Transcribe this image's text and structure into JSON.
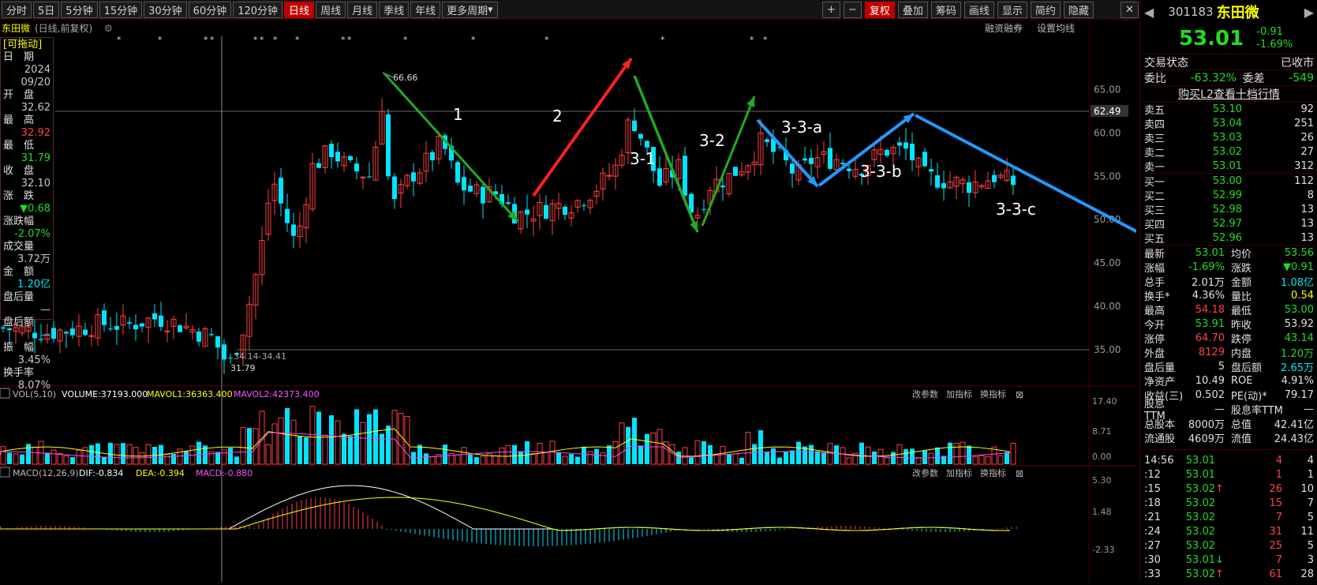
{
  "toolbar": {
    "periods": [
      "分时",
      "5日",
      "5分钟",
      "15分钟",
      "30分钟",
      "60分钟",
      "120分钟",
      "日线",
      "周线",
      "月线",
      "季线",
      "年线",
      "更多周期"
    ],
    "active": "日线",
    "right_buttons": [
      "+",
      "−",
      "复权",
      "叠加",
      "筹码",
      "画线",
      "显示",
      "简约",
      "隐藏"
    ]
  },
  "chart_header": {
    "name": "东田微",
    "mode": "(日线,前复权)",
    "links": [
      "融资融券",
      "设置均线"
    ]
  },
  "infopanel": {
    "drag": "[可拖动]",
    "rows": [
      {
        "label": "日　期",
        "value": "2024"
      },
      {
        "label": "",
        "value": "09/20"
      },
      {
        "label": "开　盘",
        "value": "32.62"
      },
      {
        "label": "最　高",
        "value": "32.92"
      },
      {
        "label": "最　低",
        "value": "31.79"
      },
      {
        "label": "收　盘",
        "value": "32.10"
      },
      {
        "label": "涨　跌",
        "value": "▼0.68"
      },
      {
        "label": "涨跌幅",
        "value": "-2.07%"
      },
      {
        "label": "成交量",
        "value": ""
      },
      {
        "label": "",
        "value": "3.72万"
      },
      {
        "label": "金　额",
        "value": ""
      },
      {
        "label": "",
        "value": "1.20亿"
      },
      {
        "label": "盘后量",
        "value": "—"
      },
      {
        "label": "盘后额",
        "value": "—"
      },
      {
        "label": "振　幅",
        "value": ""
      },
      {
        "label": "",
        "value": "3.45%"
      },
      {
        "label": "换手率",
        "value": ""
      },
      {
        "label": "",
        "value": "8.07%"
      }
    ]
  },
  "price_axis": [
    "65.00",
    "62.49",
    "60.00",
    "55.00",
    "50.00",
    "45.00",
    "40.00",
    "35.00"
  ],
  "annotations": {
    "high_label": "66.66",
    "low_label": "31.79",
    "range_label": "34.14-34.41",
    "waves": [
      "1",
      "2",
      "3-1",
      "3-2",
      "3-3-a",
      "3-3-b",
      "3-3-c"
    ]
  },
  "vol_panel": {
    "title": "VOL(5,10)",
    "volume": "VOLUME:37193.000",
    "mavol1": "MAVOL1:36363.400",
    "mavol2": "MAVOL2:42373.400",
    "links": [
      "改参数",
      "加指标",
      "换指标"
    ],
    "axis": [
      "17.40",
      "8.71",
      "0.00"
    ]
  },
  "macd_panel": {
    "title": "MACD(12,26,9)",
    "dif": "DIF:-0.834",
    "dea": "DEA:-0.394",
    "macd": "MACD:-0.880",
    "links": [
      "改参数",
      "加指标",
      "换指标"
    ],
    "axis": [
      "5.30",
      "1.48",
      "-2.33"
    ]
  },
  "quote": {
    "code": "301183",
    "name": "东田微",
    "price": "53.01",
    "change": "-0.91",
    "pct": "-1.69%",
    "status_label": "交易状态",
    "status": "已收市",
    "weibi_label": "委比",
    "weibi": "-63.32%",
    "weicha_label": "委差",
    "weicha": "-549",
    "l2": "购买L2查看十档行情",
    "asks": [
      {
        "label": "卖五",
        "price": "53.10",
        "vol": "92"
      },
      {
        "label": "卖四",
        "price": "53.04",
        "vol": "251"
      },
      {
        "label": "卖三",
        "price": "53.03",
        "vol": "26"
      },
      {
        "label": "卖二",
        "price": "53.02",
        "vol": "27"
      },
      {
        "label": "卖一",
        "price": "53.01",
        "vol": "312"
      }
    ],
    "bids": [
      {
        "label": "买一",
        "price": "53.00",
        "vol": "112"
      },
      {
        "label": "买二",
        "price": "52.99",
        "vol": "8"
      },
      {
        "label": "买三",
        "price": "52.98",
        "vol": "13"
      },
      {
        "label": "买四",
        "price": "52.97",
        "vol": "13"
      },
      {
        "label": "买五",
        "price": "52.96",
        "vol": "13"
      }
    ],
    "stats": [
      {
        "l1": "最新",
        "v1": "53.01",
        "c1": "g",
        "l2": "均价",
        "v2": "53.56",
        "c2": "g"
      },
      {
        "l1": "涨幅",
        "v1": "-1.69%",
        "c1": "g",
        "l2": "涨跌",
        "v2": "▼0.91",
        "c2": "g"
      },
      {
        "l1": "总手",
        "v1": "2.01万",
        "c1": "w",
        "l2": "金额",
        "v2": "1.08亿",
        "c2": "c"
      },
      {
        "l1": "换手*",
        "v1": "4.36%",
        "c1": "w",
        "l2": "量比",
        "v2": "0.54",
        "c2": "y"
      },
      {
        "l1": "最高",
        "v1": "54.18",
        "c1": "r",
        "l2": "最低",
        "v2": "53.00",
        "c2": "g"
      },
      {
        "l1": "今开",
        "v1": "53.91",
        "c1": "g",
        "l2": "昨收",
        "v2": "53.92",
        "c2": "w"
      },
      {
        "l1": "涨停",
        "v1": "64.70",
        "c1": "r",
        "l2": "跌停",
        "v2": "43.14",
        "c2": "g"
      },
      {
        "l1": "外盘",
        "v1": "8129",
        "c1": "r",
        "l2": "内盘",
        "v2": "1.20万",
        "c2": "g"
      },
      {
        "l1": "盘后量",
        "v1": "5",
        "c1": "w",
        "l2": "盘后额",
        "v2": "2.65万",
        "c2": "c"
      },
      {
        "l1": "净资产",
        "v1": "10.49",
        "c1": "w",
        "l2": "ROE",
        "v2": "4.91%",
        "c2": "w"
      },
      {
        "l1": "收益(三)",
        "v1": "0.502",
        "c1": "w",
        "l2": "PE(动)*",
        "v2": "79.17",
        "c2": "w"
      },
      {
        "l1": "股息TTM",
        "v1": "—",
        "c1": "w",
        "l2": "股息率TTM",
        "v2": "—",
        "c2": "w"
      },
      {
        "l1": "总股本",
        "v1": "8000万",
        "c1": "w",
        "l2": "总值",
        "v2": "42.41亿",
        "c2": "w"
      },
      {
        "l1": "流通股",
        "v1": "4609万",
        "c1": "w",
        "l2": "流值",
        "v2": "24.43亿",
        "c2": "w"
      }
    ],
    "ticks": [
      {
        "time": "14:56",
        "price": "53.01",
        "arrow": "",
        "vol": "4",
        "n": "4",
        "c": "r"
      },
      {
        "time": ":12",
        "price": "53.01",
        "arrow": "",
        "vol": "1",
        "n": "1",
        "c": "r"
      },
      {
        "time": ":15",
        "price": "53.02",
        "arrow": "↑",
        "vol": "26",
        "n": "10",
        "c": "r"
      },
      {
        "time": ":18",
        "price": "53.02",
        "arrow": "",
        "vol": "15",
        "n": "7",
        "c": "r"
      },
      {
        "time": ":21",
        "price": "53.02",
        "arrow": "",
        "vol": "7",
        "n": "5",
        "c": "r"
      },
      {
        "time": ":24",
        "price": "53.02",
        "arrow": "",
        "vol": "31",
        "n": "11",
        "c": "r"
      },
      {
        "time": ":27",
        "price": "53.02",
        "arrow": "",
        "vol": "25",
        "n": "5",
        "c": "r"
      },
      {
        "time": ":30",
        "price": "53.01",
        "arrow": "↓",
        "vol": "7",
        "n": "3",
        "c": "g"
      },
      {
        "time": ":33",
        "price": "53.02",
        "arrow": "↑",
        "vol": "61",
        "n": "28",
        "c": "r"
      }
    ]
  }
}
